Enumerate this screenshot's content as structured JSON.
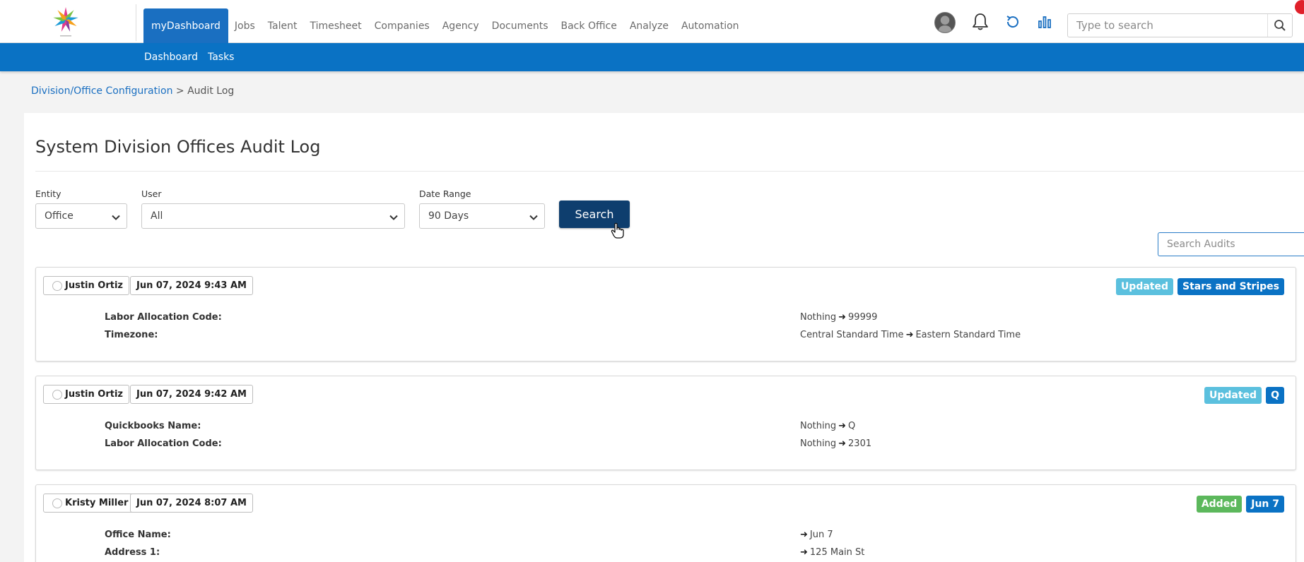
{
  "nav": {
    "items": [
      {
        "label": "myDashboard",
        "active": true
      },
      {
        "label": "Jobs",
        "active": false
      },
      {
        "label": "Talent",
        "active": false
      },
      {
        "label": "Timesheet",
        "active": false
      },
      {
        "label": "Companies",
        "active": false
      },
      {
        "label": "Agency",
        "active": false
      },
      {
        "label": "Documents",
        "active": false
      },
      {
        "label": "Back Office",
        "active": false
      },
      {
        "label": "Analyze",
        "active": false
      },
      {
        "label": "Automation",
        "active": false
      }
    ],
    "search_placeholder": "Type to search"
  },
  "subnav": {
    "items": [
      "Dashboard",
      "Tasks"
    ]
  },
  "breadcrumb": {
    "parent": "Division/Office Configuration",
    "separator": " > ",
    "current": "Audit Log"
  },
  "page": {
    "title": "System Division Offices Audit Log"
  },
  "filters": {
    "entity_label": "Entity",
    "entity_value": "Office",
    "user_label": "User",
    "user_value": "All",
    "date_label": "Date Range",
    "date_value": "90 Days",
    "search_button": "Search",
    "audit_search_placeholder": "Search Audits"
  },
  "audits": [
    {
      "user": "Justin Ortiz",
      "timestamp": "Jun 07, 2024 9:43 AM",
      "action": "Updated",
      "entity": "Stars and Stripes",
      "changes": [
        {
          "field": "Labor Allocation Code:",
          "from": "Nothing",
          "to": "99999"
        },
        {
          "field": "Timezone:",
          "from": "Central Standard Time",
          "to": "Eastern Standard Time"
        }
      ]
    },
    {
      "user": "Justin Ortiz",
      "timestamp": "Jun 07, 2024 9:42 AM",
      "action": "Updated",
      "entity": "Q",
      "changes": [
        {
          "field": "Quickbooks Name:",
          "from": "Nothing",
          "to": "Q"
        },
        {
          "field": "Labor Allocation Code:",
          "from": "Nothing",
          "to": "2301"
        }
      ]
    },
    {
      "user": "Kristy Miller",
      "timestamp": "Jun 07, 2024 8:07 AM",
      "action": "Added",
      "entity": "Jun 7",
      "changes": [
        {
          "field": "Office Name:",
          "from": "",
          "to": "Jun 7"
        },
        {
          "field": "Address 1:",
          "from": "",
          "to": "125 Main St"
        }
      ]
    }
  ],
  "colors": {
    "primary": "#1a6fc1",
    "subbar": "#0a72c4",
    "search_button": "#0e3e6e",
    "updated": "#5bc0de",
    "added": "#5cb85c"
  },
  "icons": {
    "logo": "star-burst-logo",
    "bell": "bell-icon",
    "refresh": "refresh-icon",
    "analytics": "bar-chart-icon",
    "search": "search-icon"
  }
}
